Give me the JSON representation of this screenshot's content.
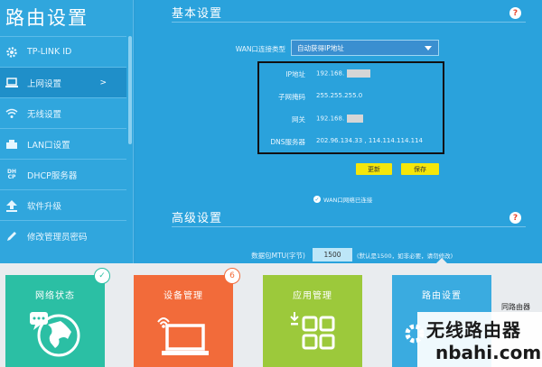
{
  "sidebar": {
    "title": "路由设置",
    "items": [
      {
        "label": "TP-LINK ID",
        "icon": "gear-icon"
      },
      {
        "label": "上网设置",
        "icon": "laptop-icon",
        "arrow": ">"
      },
      {
        "label": "无线设置",
        "icon": "wifi-icon"
      },
      {
        "label": "LAN口设置",
        "icon": "lan-port-icon"
      },
      {
        "label": "DHCP服务器",
        "icon": "dhcp-icon"
      },
      {
        "label": "软件升级",
        "icon": "upload-icon"
      },
      {
        "label": "修改管理员密码",
        "icon": "pencil-icon"
      }
    ]
  },
  "basic": {
    "title": "基本设置",
    "help": "?",
    "wan_type_label": "WAN口连接类型",
    "wan_type_value": "自动获得IP地址",
    "ip_label": "IP地址",
    "ip_value": "192.168.",
    "mask_label": "子网掩码",
    "mask_value": "255.255.255.0",
    "gateway_label": "网关",
    "gateway_value": "192.168.",
    "dns_label": "DNS服务器",
    "dns_value": "202.96.134.33 , 114.114.114.114",
    "renew_button": "更新",
    "save_button": "保存",
    "status": "WAN口网络已连接"
  },
  "advanced": {
    "title": "高级设置",
    "help": "?",
    "mtu_label": "数据包MTU(字节)",
    "mtu_value": "1500",
    "mtu_hint": "(默认是1500，如非必要，请勿修改)"
  },
  "tiles": [
    {
      "label": "网络状态",
      "color": "#2bbfa4",
      "badge": "✓"
    },
    {
      "label": "设备管理",
      "color": "#f26b3a",
      "badge": "6"
    },
    {
      "label": "应用管理",
      "color": "#9cc93b"
    },
    {
      "label": "路由设置",
      "color": "#3aabe0"
    }
  ],
  "cutoff_text": "同路由器",
  "watermark": {
    "top": "无线路由器",
    "bottom": "nbahi.com"
  },
  "colors": {
    "main": "#2aa2dc",
    "sidebar": "#30a6dd",
    "button": "#f5e60a",
    "help": "#e8442c"
  }
}
